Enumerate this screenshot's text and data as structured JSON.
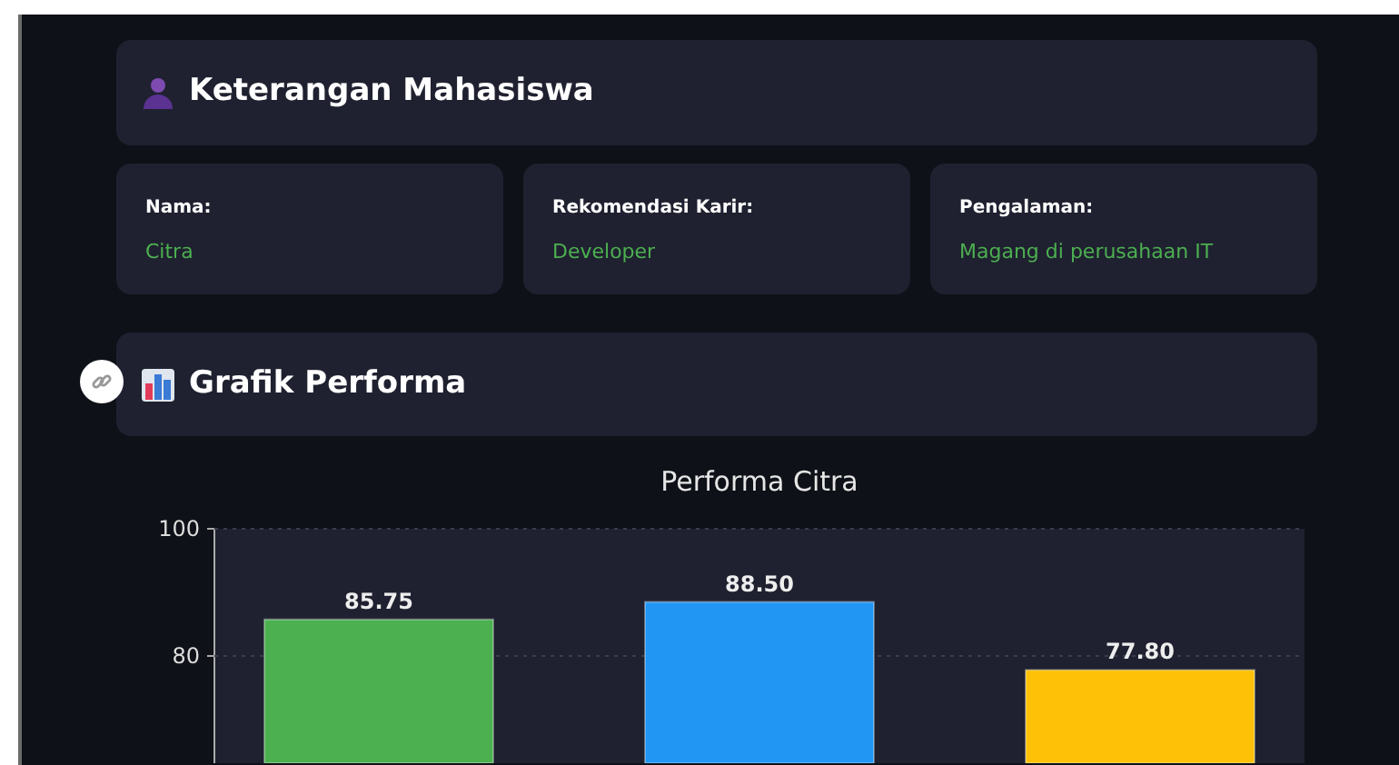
{
  "student_section": {
    "title": "Keterangan Mahasiswa"
  },
  "info_cards": [
    {
      "label": "Nama:",
      "value": "Citra"
    },
    {
      "label": "Rekomendasi Karir:",
      "value": "Developer"
    },
    {
      "label": "Pengalaman:",
      "value": "Magang di perusahaan IT"
    }
  ],
  "chart_section": {
    "title": "Grafik Performa",
    "chart_data": {
      "type": "bar",
      "title": "Performa Citra",
      "ylim": [
        63,
        100
      ],
      "yticks": [
        80,
        100
      ],
      "data_labels": true,
      "series": [
        {
          "values": [
            85.75,
            88.5,
            77.8
          ],
          "colors": [
            "#4caf50",
            "#2196f3",
            "#ffc107"
          ],
          "value_labels": [
            "85.75",
            "88.50",
            "77.80"
          ]
        }
      ]
    }
  }
}
